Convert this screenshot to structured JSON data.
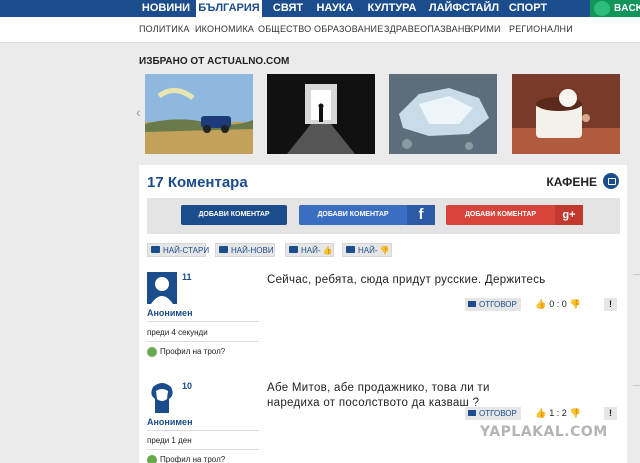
{
  "topnav": {
    "items": [
      "НОВИНИ",
      "БЪЛГАРИЯ",
      "СВЯТ",
      "НАУКА",
      "КУЛТУРА",
      "ЛАЙФСТАЙЛ",
      "СПОРТ"
    ],
    "active": "БЪЛГАРИЯ",
    "back_label": "BACK"
  },
  "subnav": {
    "items": [
      "ПОЛИТИКА",
      "ИКОНОМИКА",
      "ОБЩЕСТВО",
      "ОБРАЗОВАНИЕ",
      "ЗДРАВЕОПАЗВАНЕ",
      "КРИМИ",
      "РЕГИОНАЛНИ"
    ]
  },
  "featured": {
    "title": "ИЗБРАНО ОТ ACTUALNO.COM"
  },
  "comments": {
    "count_label": "17 Коментара",
    "kafene_label": "КАФЕНЕ",
    "add_buttons": [
      {
        "label": "ДОБАВИ КОМЕНТАР",
        "color": "#1b4d8c",
        "icon": ""
      },
      {
        "label": "ДОБАВИ КОМЕНТАР",
        "color": "#3b6ec2",
        "icon": "f"
      },
      {
        "label": "ДОБАВИ КОМЕНТАР",
        "color": "#d9443a",
        "icon": "g+"
      }
    ],
    "sorts": [
      "НАЙ-СТАРИ",
      "НАЙ-НОВИ",
      "НАЙ-",
      "НАЙ-"
    ],
    "items": [
      {
        "number": "11",
        "author": "Анонимен",
        "time": "преди 4 секунди",
        "troll_label": "Профил на трол?",
        "text": "Сейчас, ребята, сюда придут русские. Держитесь",
        "reply_label": "ОТГОВОР",
        "up": "0",
        "down": "0",
        "flag": "!"
      },
      {
        "number": "10",
        "author": "Анонимен",
        "time": "преди 1 ден",
        "troll_label": "Профил на трол?",
        "text": "Абе Митов, абе продажнико, това ли ти наредиха от посолството да казваш ?",
        "reply_label": "ОТГОВОР",
        "up": "1",
        "down": "2",
        "flag": "!"
      }
    ],
    "vote_separator": ":"
  },
  "watermark": "YAPLAKAL.COM"
}
